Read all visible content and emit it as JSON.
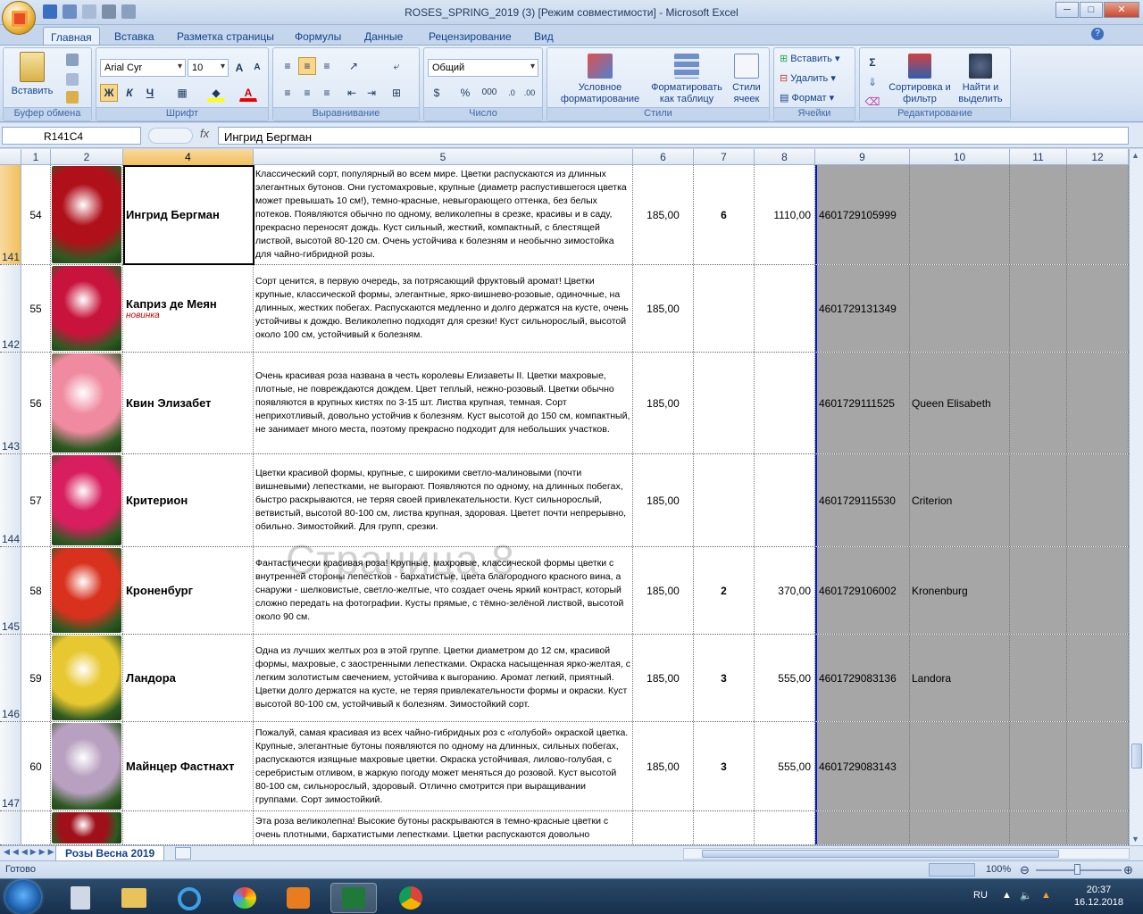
{
  "window": {
    "title": "ROSES_SPRING_2019 (3)  [Режим совместимости] - Microsoft Excel",
    "minimize": "─",
    "maximize": "□",
    "close": "✕"
  },
  "tabs": [
    "Главная",
    "Вставка",
    "Разметка страницы",
    "Формулы",
    "Данные",
    "Рецензирование",
    "Вид"
  ],
  "ribbon": {
    "clipboard": {
      "label": "Буфер обмена",
      "paste": "Вставить"
    },
    "font": {
      "label": "Шрифт",
      "name": "Arial Cyr",
      "size": "10",
      "bold": "Ж",
      "italic": "К",
      "underline": "Ч",
      "grow": "A",
      "shrink": "A"
    },
    "alignment": {
      "label": "Выравнивание"
    },
    "number": {
      "label": "Число",
      "format": "Общий",
      "percent": "%",
      "thousands": "000"
    },
    "styles": {
      "label": "Стили",
      "cond": "Условное форматирование",
      "table": "Форматировать как таблицу",
      "cell": "Стили ячеек"
    },
    "cells": {
      "label": "Ячейки",
      "insert": "Вставить",
      "delete": "Удалить",
      "format": "Формат"
    },
    "editing": {
      "label": "Редактирование",
      "sort": "Сортировка и фильтр",
      "find": "Найти и выделить"
    }
  },
  "formula_bar": {
    "name_box": "R141C4",
    "fx": "fx",
    "content": "Ингрид Бергман"
  },
  "columns": [
    "1",
    "2",
    "4",
    "5",
    "6",
    "7",
    "8",
    "9",
    "10",
    "11",
    "12"
  ],
  "rows": [
    {
      "row": "141",
      "num": "54",
      "name": "Ингрид Бергман",
      "note": "",
      "desc": "Классический сорт, популярный во всем мире. Цветки распускаются из длинных элегантных бутонов. Они густомахровые, крупные (диаметр распустившегося цветка может превышать 10 см!), темно-красные, невыгорающего оттенка, без белых потеков. Появляются обычно по одному, великолепны в срезке, красивы и в саду, прекрасно переносят дождь. Куст сильный, жесткий, компактный, с блестящей листвой, высотой 80-120 см. Очень устойчива к болезням и необычно зимостойка для чайно-гибридной розы.",
      "price": "185,00",
      "qty": "6",
      "sum": "1110,00",
      "code": "4601729105999",
      "latin": "",
      "color": "#b0101a"
    },
    {
      "row": "142",
      "num": "55",
      "name": "Каприз де Меян",
      "note": "новинка",
      "desc": "Сорт ценится, в первую очередь, за потрясающий фруктовый аромат! Цветки крупные, классической формы, элегантные, ярко-вишнево-розовые, одиночные, на длинных, жестких побегах. Распускаются медленно и долго держатся на кусте, очень устойчивы к дождю. Великолепно подходят для срезки! Куст сильнорослый, высотой около 100 см, устойчивый к болезням.",
      "price": "185,00",
      "qty": "",
      "sum": "",
      "code": "4601729131349",
      "latin": "",
      "color": "#c8143c"
    },
    {
      "row": "143",
      "num": "56",
      "name": "Квин Элизабет",
      "note": "",
      "desc": "Очень красивая роза названа в честь королевы Елизаветы II. Цветки махровые, плотные, не повреждаются дождем. Цвет теплый, нежно-розовый. Цветки обычно появляются в крупных кистях по 3-15 шт. Листва крупная, темная. Сорт неприхотливый, довольно устойчив к болезням. Куст высотой до 150 см, компактный, не занимает много места, поэтому прекрасно подходит для небольших участков.",
      "price": "185,00",
      "qty": "",
      "sum": "",
      "code": "4601729111525",
      "latin": "Queen Elisabeth",
      "color": "#f08aa0"
    },
    {
      "row": "144",
      "num": "57",
      "name": "Критерион",
      "note": "",
      "desc": "Цветки красивой формы, крупные, с широкими светло-малиновыми (почти вишневыми) лепестками, не выгорают. Появляются по одному, на длинных побегах, быстро раскрываются, не теряя своей привлекательности. Куст сильнорослый, ветвистый, высотой 80-100 см, листва крупная, здоровая. Цветет почти непрерывно, обильно.  Зимостойкий.  Для групп, срезки.",
      "price": "185,00",
      "qty": "",
      "sum": "",
      "code": "4601729115530",
      "latin": "Criterion",
      "color": "#d81e5e"
    },
    {
      "row": "145",
      "num": "58",
      "name": "Кроненбург",
      "note": "",
      "desc": "Фантастически красивая роза! Крупные, махровые, классической формы цветки с внутренней стороны лепестков - бархатистые, цвета благородного красного вина, а снаружи - шелковистые, светло-желтые, что создает очень яркий контраст, который сложно передать на фотографии. Кусты прямые, с тёмно-зелёной листвой, высотой около 90 см.",
      "price": "185,00",
      "qty": "2",
      "sum": "370,00",
      "code": "4601729106002",
      "latin": "Kronenburg",
      "color": "#d8321e"
    },
    {
      "row": "146",
      "num": "59",
      "name": "Ландора",
      "note": "",
      "desc": "Одна из лучших желтых роз в этой группе. Цветки диаметром до 12 см, красивой формы, махровые, с заостренными лепестками. Окраска насыщенная ярко-желтая, с легким золотистым свечением, устойчива к выгоранию. Аромат легкий, приятный. Цветки долго держатся на кусте, не теряя привлекательности формы и окраски. Куст высотой 80-100 см, устойчивый к болезням. Зимостойкий сорт.",
      "price": "185,00",
      "qty": "3",
      "sum": "555,00",
      "code": "4601729083136",
      "latin": "Landora",
      "color": "#e8c830"
    },
    {
      "row": "147",
      "num": "60",
      "name": "Майнцер Фастнахт",
      "note": "",
      "desc": "Пожалуй, самая красивая из всех чайно-гибридных роз с «голубой» окраской цветка. Крупные, элегантные бутоны появляются по одному на длинных, сильных побегах, распускаются изящные махровые цветки. Окраска устойчивая, лилово-голубая, с серебристым отливом, в жаркую погоду может меняться до розовой. Куст высотой 80-100 см, сильнорослый, здоровый. Отлично смотрится при выращивании группами. Сорт зимостойкий.",
      "price": "185,00",
      "qty": "3",
      "sum": "555,00",
      "code": "4601729083143",
      "latin": "",
      "color": "#b8a0c0"
    },
    {
      "row": "",
      "num": "",
      "name": "",
      "note": "",
      "desc": "Эта роза великолепна! Высокие бутоны раскрываются в темно-красные цветки с очень плотными, бархатистыми лепестками. Цветки распускаются довольно",
      "price": "",
      "qty": "",
      "sum": "",
      "code": "",
      "latin": "",
      "color": "#a0101a"
    }
  ],
  "watermark": "Страница 8",
  "sheet_tab": "Розы Весна 2019",
  "status": {
    "ready": "Готово",
    "zoom": "100%"
  },
  "taskbar": {
    "lang": "RU",
    "time": "20:37",
    "date": "16.12.2018"
  }
}
